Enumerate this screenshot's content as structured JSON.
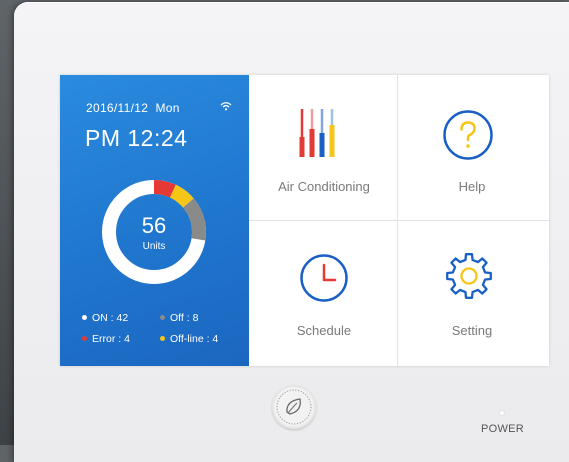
{
  "status": {
    "date": "2016/11/12",
    "weekday": "Mon",
    "time": "PM 12:24",
    "units_count": "56",
    "units_label": "Units",
    "legend": [
      {
        "label": "ON : 42",
        "color": "#ffffff"
      },
      {
        "label": "Off : 8",
        "color": "#8a8a8a"
      },
      {
        "label": "Error : 4",
        "color": "#e53935"
      },
      {
        "label": "Off-line : 4",
        "color": "#f5c518"
      }
    ],
    "donut_counts": {
      "on": 42,
      "error": 4,
      "offline": 4,
      "off": 8
    }
  },
  "menu": {
    "air_conditioning": "Air Conditioning",
    "help": "Help",
    "schedule": "Schedule",
    "setting": "Setting"
  },
  "hardware": {
    "power_label": "POWER"
  },
  "colors": {
    "panel_blue": "#1f74cc",
    "accent_blue": "#1a5fc4",
    "accent_yellow": "#f5c518",
    "accent_red": "#e53935"
  },
  "icons": [
    "wifi-icon",
    "air-conditioning-icon",
    "help-icon",
    "clock-icon",
    "gear-icon",
    "leaf-icon"
  ]
}
